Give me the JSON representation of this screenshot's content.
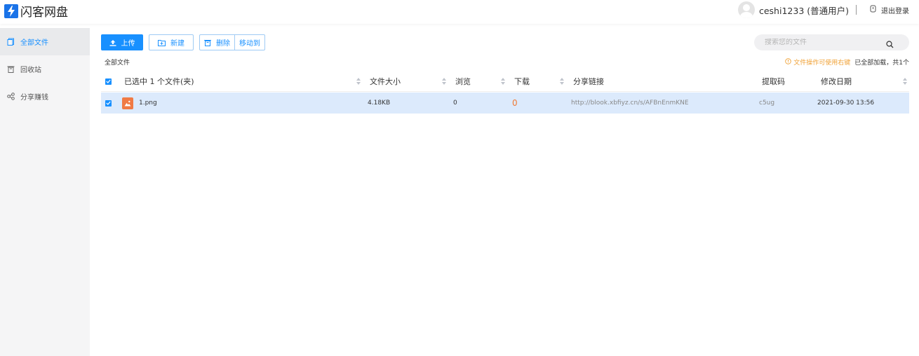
{
  "app": {
    "title": "闪客网盘",
    "accent": "#1890ff"
  },
  "header": {
    "username": "ceshi1233 (普通用户)",
    "logout_label": "退出登录"
  },
  "sidebar": {
    "items": [
      {
        "label": "全部文件",
        "icon": "files-icon",
        "active": true
      },
      {
        "label": "回收站",
        "icon": "trash-icon",
        "active": false
      },
      {
        "label": "分享赚钱",
        "icon": "share-icon",
        "active": false
      }
    ]
  },
  "toolbar": {
    "upload_label": "上传",
    "new_label": "新建",
    "delete_label": "删除",
    "move_label": "移动到"
  },
  "search": {
    "placeholder": "搜索您的文件",
    "value": ""
  },
  "breadcrumb": "全部文件",
  "tip": {
    "warning": "文件操作可使用右键",
    "loaded": "已全部加载，共1个"
  },
  "table": {
    "columns": {
      "name": "已选中 1 个文件(夹)",
      "size": "文件大小",
      "views": "浏览",
      "downloads": "下载",
      "share_link": "分享链接",
      "code": "提取码",
      "modified": "修改日期"
    },
    "rows": [
      {
        "selected": true,
        "name": "1.png",
        "size": "4.18KB",
        "views": "0",
        "downloads": "0",
        "share_link": "http://blook.xbfiyz.cn/s/AFBnEnmKNE",
        "code": "c5ug",
        "modified": "2021-09-30 13:56"
      }
    ]
  }
}
